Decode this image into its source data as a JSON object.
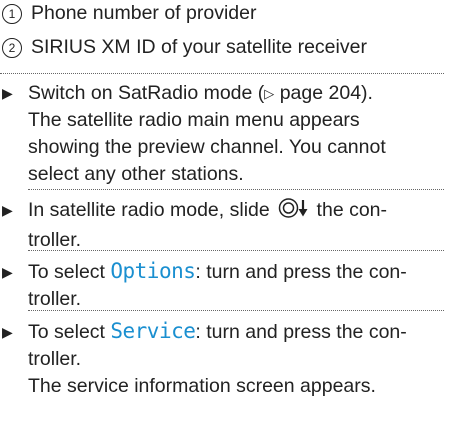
{
  "legend": [
    {
      "number": "1",
      "text": "Phone number of provider"
    },
    {
      "number": "2",
      "text": "SIRIUS XM ID of your satellite receiver"
    }
  ],
  "steps": {
    "s1": {
      "line1_pre": "Switch on SatRadio mode (",
      "page_ref_symbol": "▷",
      "line1_post": " page 204).",
      "line2": "The satellite radio main menu appears",
      "line3": "showing the preview channel. You cannot",
      "line4": "select any other stations."
    },
    "s2": {
      "line1_pre": "In satellite radio mode, slide ",
      "line1_post": " the con-",
      "line2": "troller."
    },
    "s3": {
      "line1_pre": "To select ",
      "menu_item": "Options",
      "line1_post": ": turn and press the con-",
      "line2": "troller."
    },
    "s4": {
      "line1_pre": "To select ",
      "menu_item": "Service",
      "line1_post": ": turn and press the con-",
      "line2": "troller.",
      "line3": "The service information screen appears."
    }
  },
  "icons": {
    "step_bullet": "black-right-triangle-icon",
    "controller_slide": "controller-slide-down-icon"
  },
  "colors": {
    "menu_item": "#1a8fd0",
    "text": "#222222"
  }
}
